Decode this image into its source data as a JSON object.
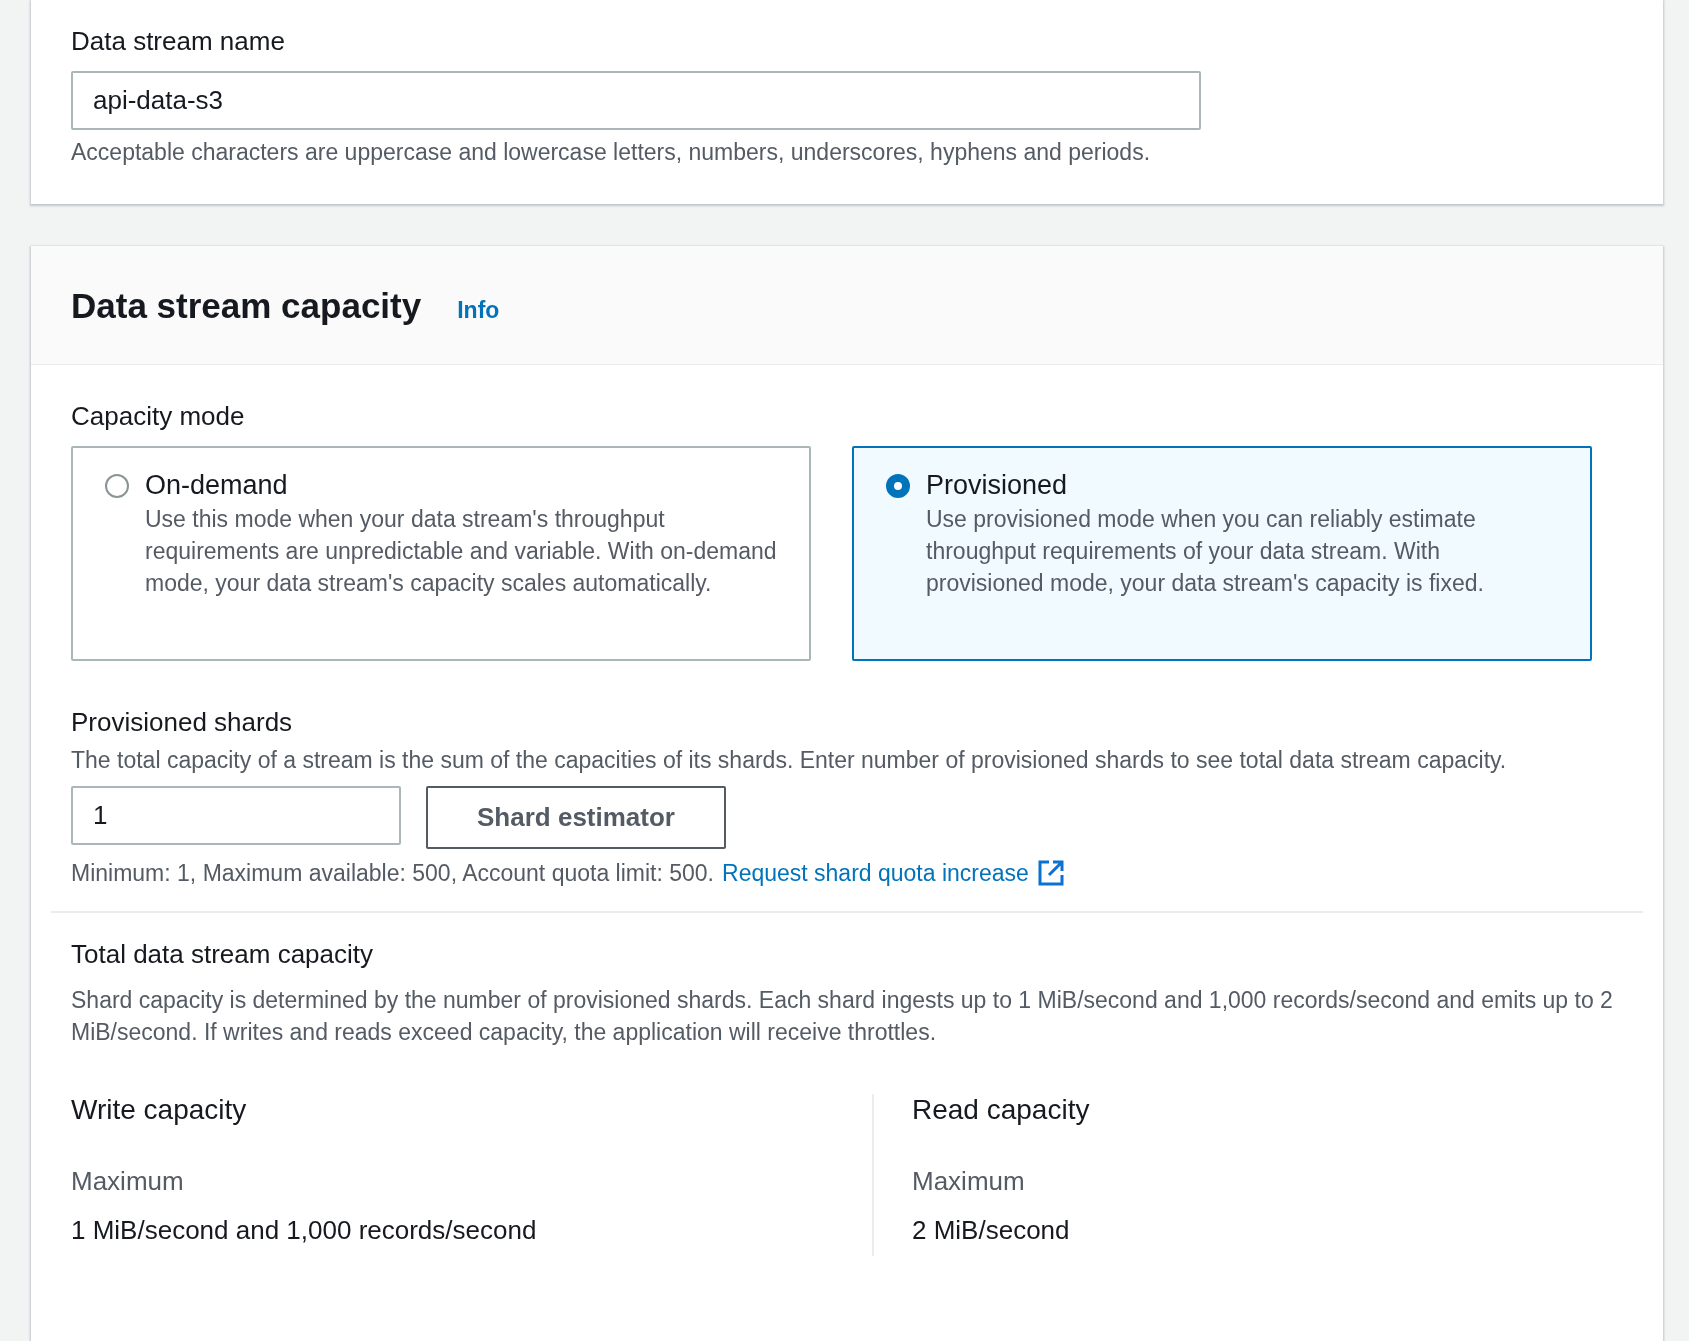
{
  "stream_name": {
    "label": "Data stream name",
    "value": "api-data-s3",
    "hint": "Acceptable characters are uppercase and lowercase letters, numbers, underscores, hyphens and periods."
  },
  "capacity": {
    "title": "Data stream capacity",
    "info_link": "Info",
    "mode": {
      "label": "Capacity mode",
      "options": [
        {
          "title": "On-demand",
          "description": "Use this mode when your data stream's throughput requirements are unpredictable and variable. With on-demand mode, your data stream's capacity scales automatically.",
          "selected": false
        },
        {
          "title": "Provisioned",
          "description": "Use provisioned mode when you can reliably estimate throughput requirements of your data stream. With provisioned mode, your data stream's capacity is fixed.",
          "selected": true
        }
      ]
    },
    "shards": {
      "label": "Provisioned shards",
      "description": "The total capacity of a stream is the sum of the capacities of its shards. Enter number of provisioned shards to see total data stream capacity.",
      "value": "1",
      "estimator_button": "Shard estimator",
      "constraint": "Minimum: 1, Maximum available: 500, Account quota limit: 500.",
      "quota_link": "Request shard quota increase"
    },
    "total": {
      "title": "Total data stream capacity",
      "description": "Shard capacity is determined by the number of provisioned shards. Each shard ingests up to 1 MiB/second and 1,000 records/second and emits up to 2 MiB/second. If writes and reads exceed capacity, the application will receive throttles.",
      "columns": [
        {
          "title": "Write capacity",
          "metric_label": "Maximum",
          "metric_value": "1 MiB/second and 1,000 records/second"
        },
        {
          "title": "Read capacity",
          "metric_label": "Maximum",
          "metric_value": "2 MiB/second"
        }
      ]
    }
  }
}
